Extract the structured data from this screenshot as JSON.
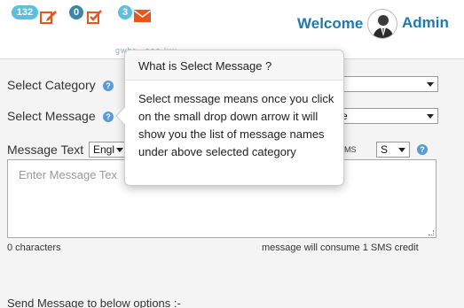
{
  "header": {
    "notifications": [
      {
        "count": "132",
        "icon": "edit-note-icon"
      },
      {
        "count": "0",
        "icon": "checkbox-edit-icon"
      },
      {
        "count": "3",
        "icon": "envelope-icon"
      }
    ],
    "welcome": "Welcome",
    "user": "Admin",
    "sub_text": "gwhr...eaa.luu",
    "accent_color": "#1e7bab",
    "icon_color": "#e8561c"
  },
  "form": {
    "category_label": "Select Category",
    "message_label": "Select Message",
    "message_select_value": "e",
    "message_text_label": "Message Text",
    "language_value": "Engl",
    "sms_label": "MS",
    "sms_select_value": "S",
    "textarea_placeholder": "Enter Message Tex",
    "char_count": "0 characters",
    "sms_credit": "message will consume 1 SMS credit",
    "send_options_label": "Send Message to below options :-"
  },
  "popover": {
    "title": "What is Select Message ?",
    "body": "Select message means once you click on the small drop down arrow it will show you the list of message names under above selected category"
  }
}
